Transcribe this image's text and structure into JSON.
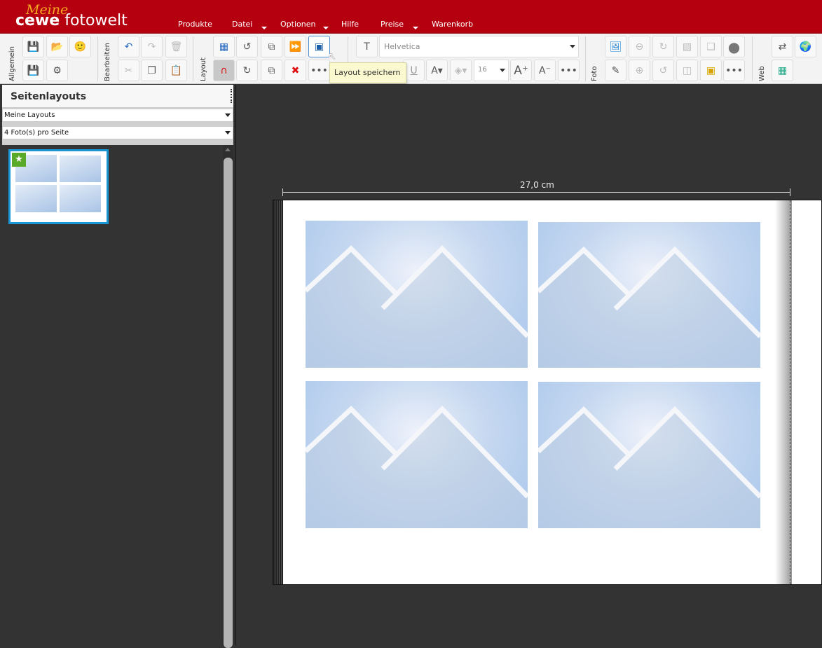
{
  "app": {
    "logo_top": "Meine",
    "logo_brand": "cewe",
    "logo_rest": "fotowelt"
  },
  "menu": [
    "Produkte",
    "Datei",
    "Optionen",
    "Hilfe",
    "Preise",
    "Warenkorb"
  ],
  "toolbar": {
    "groups": {
      "general": "Allgemein",
      "edit": "Bearbeiten",
      "layout": "Layout",
      "photo": "Foto",
      "web": "Web"
    },
    "font": "Helvetica",
    "font_size": "16",
    "underline": "U",
    "more": "•••",
    "tooltip": "Layout speichern"
  },
  "panel": {
    "title": "Seitenlayouts",
    "category": "Meine Layouts",
    "filter": "4 Foto(s) pro Seite"
  },
  "canvas": {
    "width_label": "27,0 cm"
  }
}
